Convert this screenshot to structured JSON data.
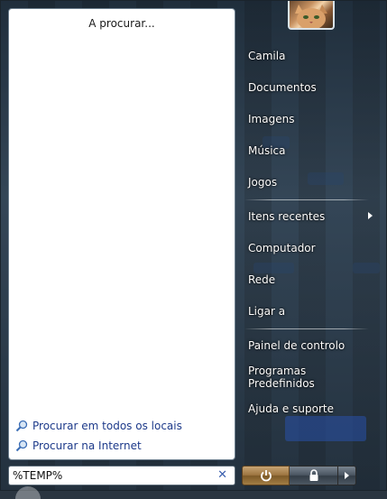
{
  "left_pane": {
    "status_text": "A procurar...",
    "search_links": [
      {
        "label": "Procurar em todos os locais",
        "icon": "search-icon"
      },
      {
        "label": "Procurar na Internet",
        "icon": "search-icon"
      }
    ]
  },
  "search": {
    "value": "%TEMP%",
    "clear_icon": "close-icon"
  },
  "user": {
    "avatar_icon": "cat-avatar"
  },
  "right_menu": {
    "items": [
      {
        "label": "Camila"
      },
      {
        "label": "Documentos"
      },
      {
        "label": "Imagens"
      },
      {
        "label": "Música"
      },
      {
        "label": "Jogos"
      },
      {
        "label": "Itens recentes",
        "has_submenu": true
      },
      {
        "label": "Computador"
      },
      {
        "label": "Rede"
      },
      {
        "label": "Ligar a"
      },
      {
        "label": "Painel de controlo"
      },
      {
        "label": "Programas Predefinidos"
      },
      {
        "label": "Ajuda e suporte"
      }
    ]
  },
  "power_buttons": {
    "power_icon": "power-icon",
    "lock_icon": "lock-icon",
    "arrow_icon": "chevron-right-icon"
  },
  "colors": {
    "link": "#1d3a8a",
    "power_button": "#9c7540",
    "menu_text": "#ffffff"
  }
}
